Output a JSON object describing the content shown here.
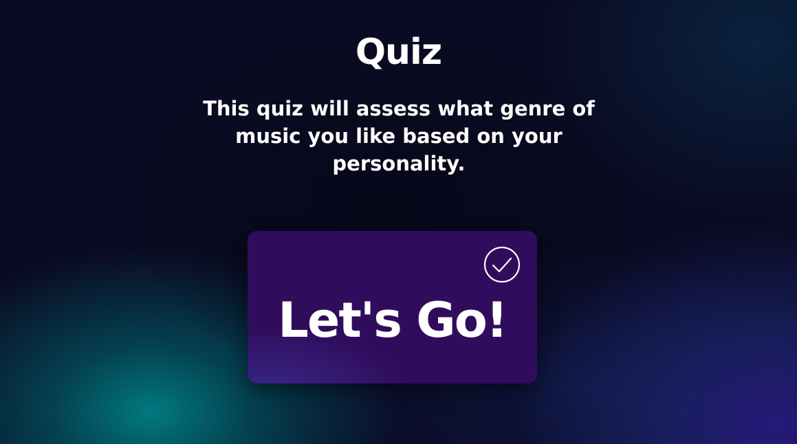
{
  "header": {
    "title": "Quiz",
    "description": "This quiz will assess what genre of music you like based on your personality."
  },
  "start_button": {
    "label": "Let's Go!",
    "icon": "check-circle-icon"
  },
  "colors": {
    "background": "#0a0a22",
    "button": "#300d5c",
    "text": "#ffffff",
    "accent_teal": "#008084",
    "accent_indigo": "#28197d"
  }
}
